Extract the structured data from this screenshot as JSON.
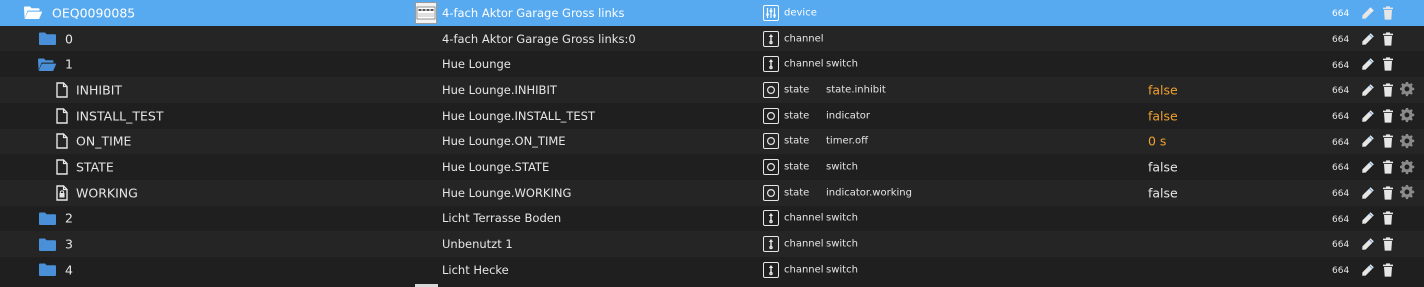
{
  "colors": {
    "selected_row": "#58aaf0",
    "background": "#1f1f1f",
    "alt_row": "#252525",
    "folder_icon": "#4a90d9",
    "value_orange": "#f0a030",
    "text": "#e6e6e6"
  },
  "rows": [
    {
      "id": "OEQ0090085",
      "level": 0,
      "icon": "folder-open-icon",
      "selected": true,
      "thumb": true,
      "name": "4-fach Aktor Garage Gross links",
      "type_icon": "device-icon",
      "type": "device",
      "role": "",
      "value": "",
      "value_color": "",
      "acl": "664",
      "settings": false
    },
    {
      "id": "0",
      "level": 1,
      "icon": "folder-icon",
      "selected": false,
      "thumb": false,
      "name": "4-fach Aktor Garage Gross links:0",
      "type_icon": "channel-icon",
      "type": "channel",
      "role": "",
      "value": "",
      "value_color": "",
      "acl": "664",
      "settings": false
    },
    {
      "id": "1",
      "level": 1,
      "icon": "folder-open-icon",
      "selected": false,
      "thumb": false,
      "name": "Hue Lounge",
      "type_icon": "channel-icon",
      "type": "channel",
      "role": "switch",
      "value": "",
      "value_color": "",
      "acl": "664",
      "settings": false
    },
    {
      "id": "INHIBIT",
      "level": 2,
      "icon": "file-icon",
      "selected": false,
      "thumb": false,
      "name": "Hue Lounge.INHIBIT",
      "type_icon": "state-icon",
      "type": "state",
      "role": "state.inhibit",
      "value": "false",
      "value_color": "orange",
      "acl": "664",
      "settings": true
    },
    {
      "id": "INSTALL_TEST",
      "level": 2,
      "icon": "file-icon",
      "selected": false,
      "thumb": false,
      "name": "Hue Lounge.INSTALL_TEST",
      "type_icon": "state-icon",
      "type": "state",
      "role": "indicator",
      "value": "false",
      "value_color": "orange",
      "acl": "664",
      "settings": true
    },
    {
      "id": "ON_TIME",
      "level": 2,
      "icon": "file-icon",
      "selected": false,
      "thumb": false,
      "name": "Hue Lounge.ON_TIME",
      "type_icon": "state-icon",
      "type": "state",
      "role": "timer.off",
      "value": "0 s",
      "value_color": "orange",
      "acl": "664",
      "settings": true
    },
    {
      "id": "STATE",
      "level": 2,
      "icon": "file-icon",
      "selected": false,
      "thumb": false,
      "name": "Hue Lounge.STATE",
      "type_icon": "state-icon",
      "type": "state",
      "role": "switch",
      "value": "false",
      "value_color": "white",
      "acl": "664",
      "settings": true
    },
    {
      "id": "WORKING",
      "level": 2,
      "icon": "file-lock-icon",
      "selected": false,
      "thumb": false,
      "name": "Hue Lounge.WORKING",
      "type_icon": "state-icon",
      "type": "state",
      "role": "indicator.working",
      "value": "false",
      "value_color": "white",
      "acl": "664",
      "settings": true
    },
    {
      "id": "2",
      "level": 1,
      "icon": "folder-icon",
      "selected": false,
      "thumb": false,
      "name": "Licht Terrasse Boden",
      "type_icon": "channel-icon",
      "type": "channel",
      "role": "switch",
      "value": "",
      "value_color": "",
      "acl": "664",
      "settings": false
    },
    {
      "id": "3",
      "level": 1,
      "icon": "folder-icon",
      "selected": false,
      "thumb": false,
      "name": "Unbenutzt 1",
      "type_icon": "channel-icon",
      "type": "channel",
      "role": "switch",
      "value": "",
      "value_color": "",
      "acl": "664",
      "settings": false
    },
    {
      "id": "4",
      "level": 1,
      "icon": "folder-icon",
      "selected": false,
      "thumb": false,
      "name": "Licht Hecke",
      "type_icon": "channel-icon",
      "type": "channel",
      "role": "switch",
      "value": "",
      "value_color": "",
      "acl": "664",
      "settings": false
    }
  ]
}
